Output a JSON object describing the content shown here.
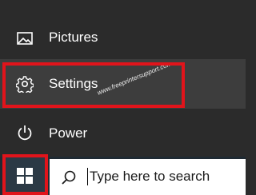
{
  "start_menu": {
    "items": [
      {
        "label": "Pictures",
        "icon": "pictures-icon"
      },
      {
        "label": "Settings",
        "icon": "gear-icon",
        "highlighted": true
      },
      {
        "label": "Power",
        "icon": "power-icon"
      }
    ]
  },
  "taskbar": {
    "start_button_icon": "windows-logo-icon",
    "search": {
      "placeholder": "Type here to search",
      "icon": "search-icon"
    }
  },
  "watermark": "www.freeprintersupport.com",
  "colors": {
    "menu_bg": "#2b2b2b",
    "hover_bg": "#3d3d3d",
    "taskbar_bg": "#1f2a33",
    "highlight_border": "#e1141b",
    "text": "#ffffff"
  }
}
